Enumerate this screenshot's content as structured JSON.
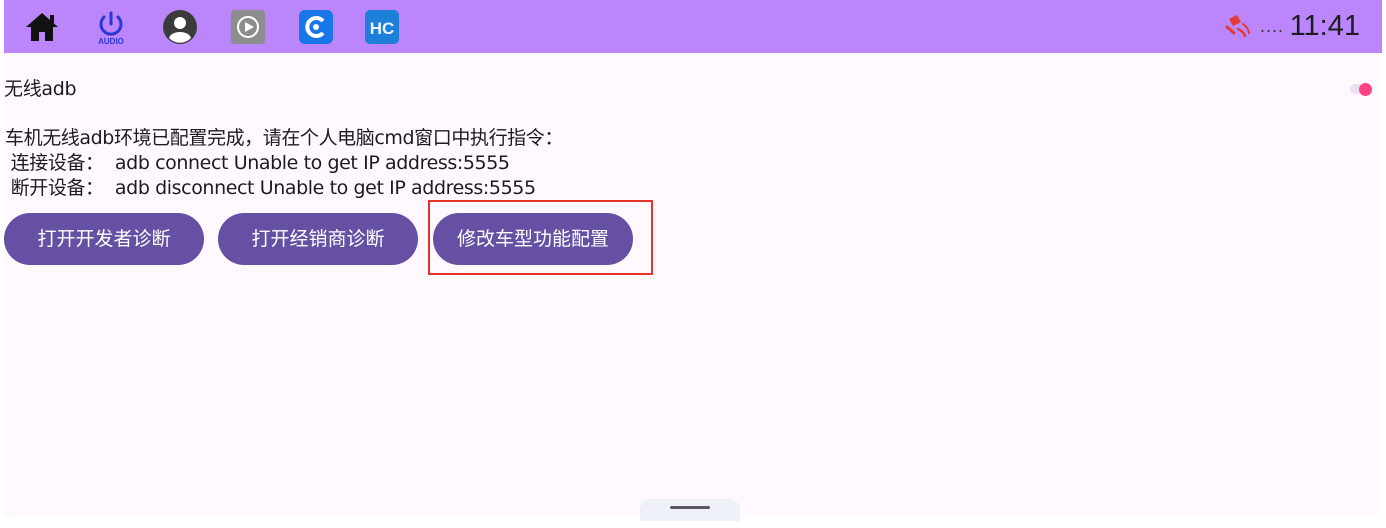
{
  "statusbar": {
    "apps": [
      {
        "icon": "home-icon"
      },
      {
        "icon": "audio-power-icon",
        "label": "AUDIO"
      },
      {
        "icon": "account-icon"
      },
      {
        "icon": "play-app-icon"
      },
      {
        "icon": "blue-c-app-icon"
      },
      {
        "icon": "hc-app-icon",
        "label": "HC"
      }
    ],
    "indicator_icon": "signal-off-icon",
    "dots": "....",
    "time": "11:41"
  },
  "setting": {
    "title": "无线adb",
    "toggle_on": true
  },
  "description": "车机无线adb环境已配置完成，请在个人电脑cmd窗口中执行指令：\n 连接设备：  adb connect Unable to get IP address:5555\n 断开设备：  adb disconnect Unable to get IP address:5555",
  "buttons": {
    "developer_diag": "打开开发者诊断",
    "dealer_diag": "打开经销商诊断",
    "vehicle_config": "修改车型功能配置"
  },
  "colors": {
    "statusbar": "#bb86fc",
    "background": "#fff9ff",
    "button": "#6650a4",
    "toggle": "#ff4081",
    "highlight": "#e5332a"
  }
}
